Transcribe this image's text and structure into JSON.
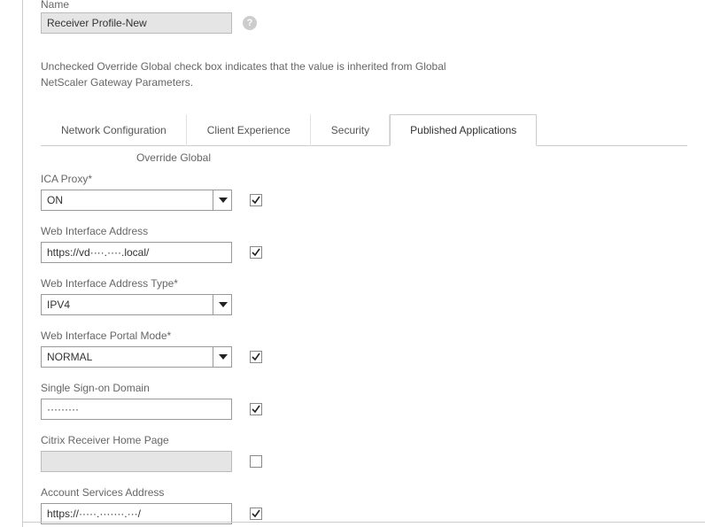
{
  "header": {
    "name_label": "Name",
    "name_value": "Receiver Profile-New"
  },
  "description": "Unchecked Override Global check box indicates that the value is inherited from Global NetScaler Gateway Parameters.",
  "tabs": [
    {
      "label": "Network Configuration"
    },
    {
      "label": "Client Experience"
    },
    {
      "label": "Security"
    },
    {
      "label": "Published Applications"
    }
  ],
  "override_header": "Override Global",
  "fields": {
    "ica_proxy": {
      "label": "ICA Proxy*",
      "value": "ON",
      "override": true
    },
    "web_interface_address": {
      "label": "Web Interface Address",
      "value": "https://vd····.····.local/",
      "override": true
    },
    "web_interface_address_type": {
      "label": "Web Interface Address Type*",
      "value": "IPV4",
      "override": false
    },
    "web_interface_portal_mode": {
      "label": "Web Interface Portal Mode*",
      "value": "NORMAL",
      "override": true
    },
    "single_signon_domain": {
      "label": "Single Sign-on Domain",
      "value": "·········",
      "override": true
    },
    "citrix_receiver_home": {
      "label": "Citrix Receiver Home Page",
      "value": "",
      "override": false
    },
    "account_services_address": {
      "label": "Account Services Address",
      "value": "https://·····.·······.···/",
      "override": true
    }
  }
}
